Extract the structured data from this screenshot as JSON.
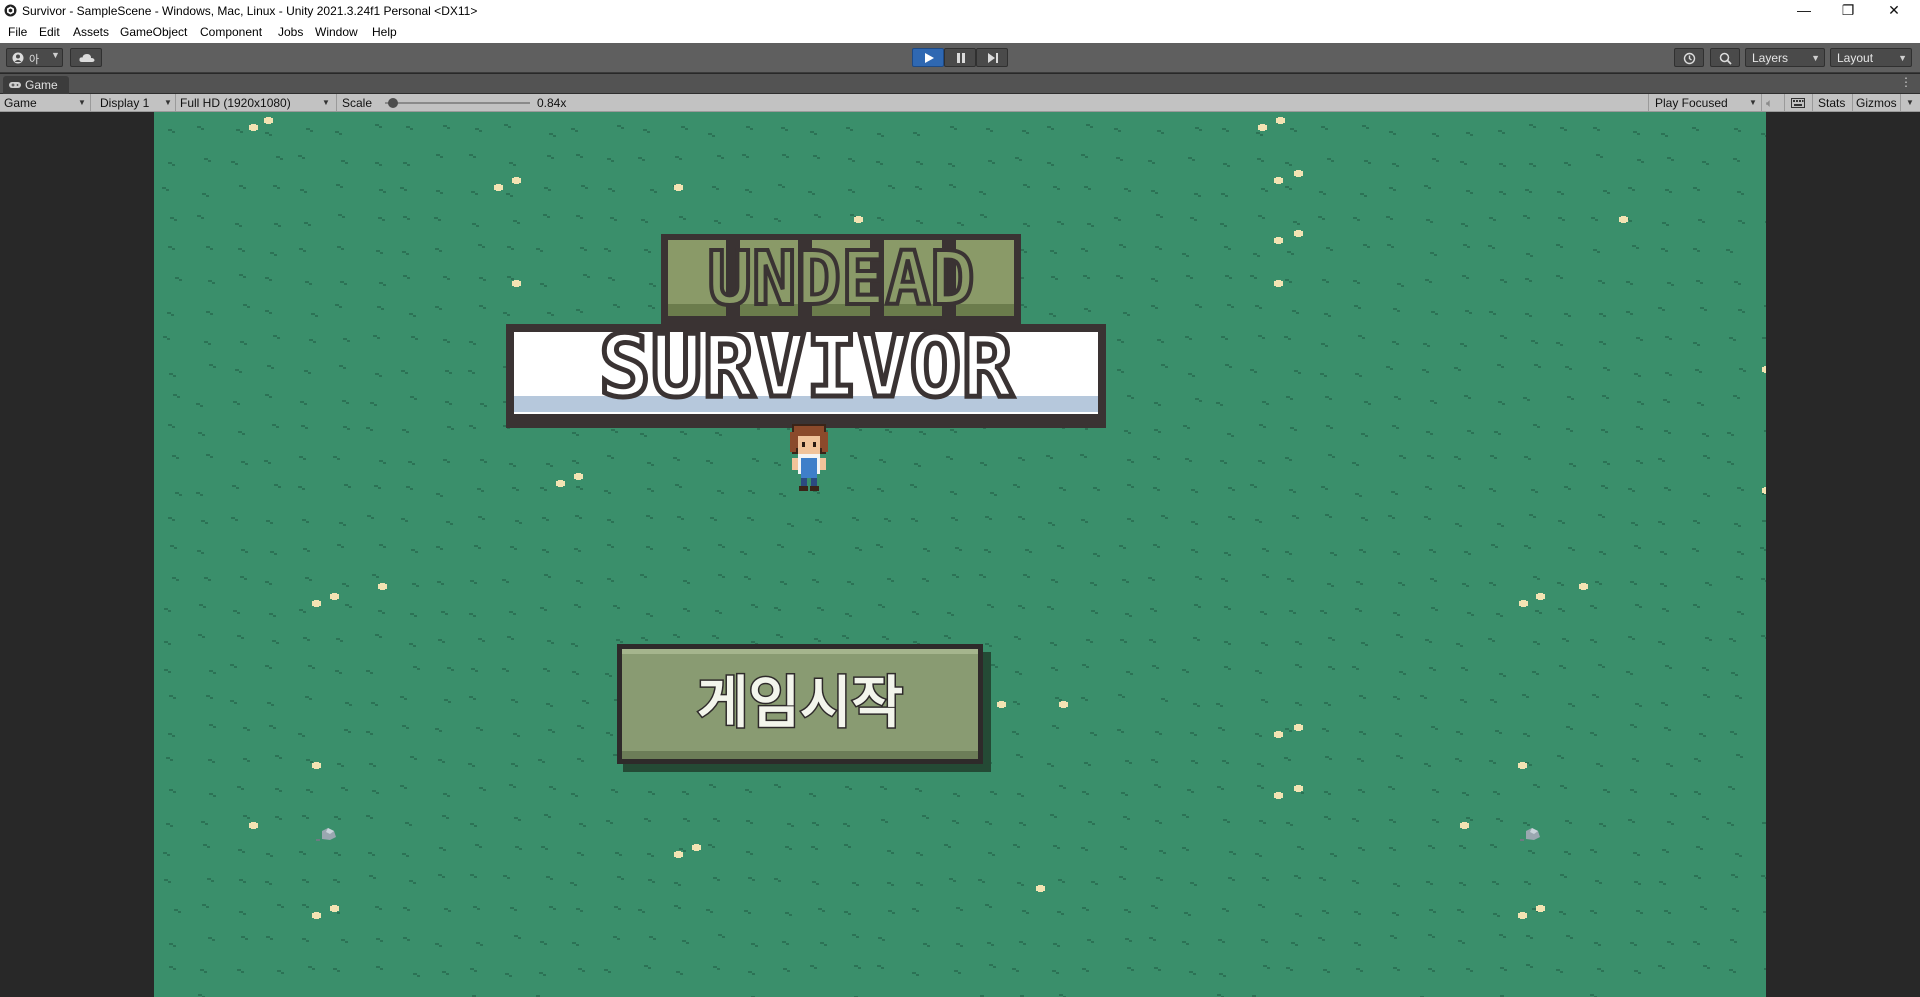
{
  "window": {
    "title": "Survivor - SampleScene - Windows, Mac, Linux - Unity 2021.3.24f1 Personal <DX11>",
    "minimize_glyph": "—",
    "restore_glyph": "❐",
    "close_glyph": "✕"
  },
  "menu": [
    "File",
    "Edit",
    "Assets",
    "GameObject",
    "Component",
    "Jobs",
    "Window",
    "Help"
  ],
  "toolbar": {
    "account_label": "아",
    "layers_label": "Layers",
    "layout_label": "Layout",
    "play_state": "playing",
    "accent_color": "#2f68b2"
  },
  "tab": {
    "label": "Game",
    "icon": "gamepad-icon"
  },
  "game_toolbar": {
    "view_mode": "Game",
    "display": "Display 1",
    "resolution": "Full HD (1920x1080)",
    "scale_label": "Scale",
    "scale_value": "0.84x",
    "scale_fraction": 0.02,
    "play_mode": "Play Focused",
    "stats_label": "Stats",
    "gizmos_label": "Gizmos"
  },
  "game": {
    "background_color": "#3a8f6b",
    "logo_line1": "UNDEAD",
    "logo_line2": "SURVIVOR",
    "start_button_label": "게임시작"
  }
}
